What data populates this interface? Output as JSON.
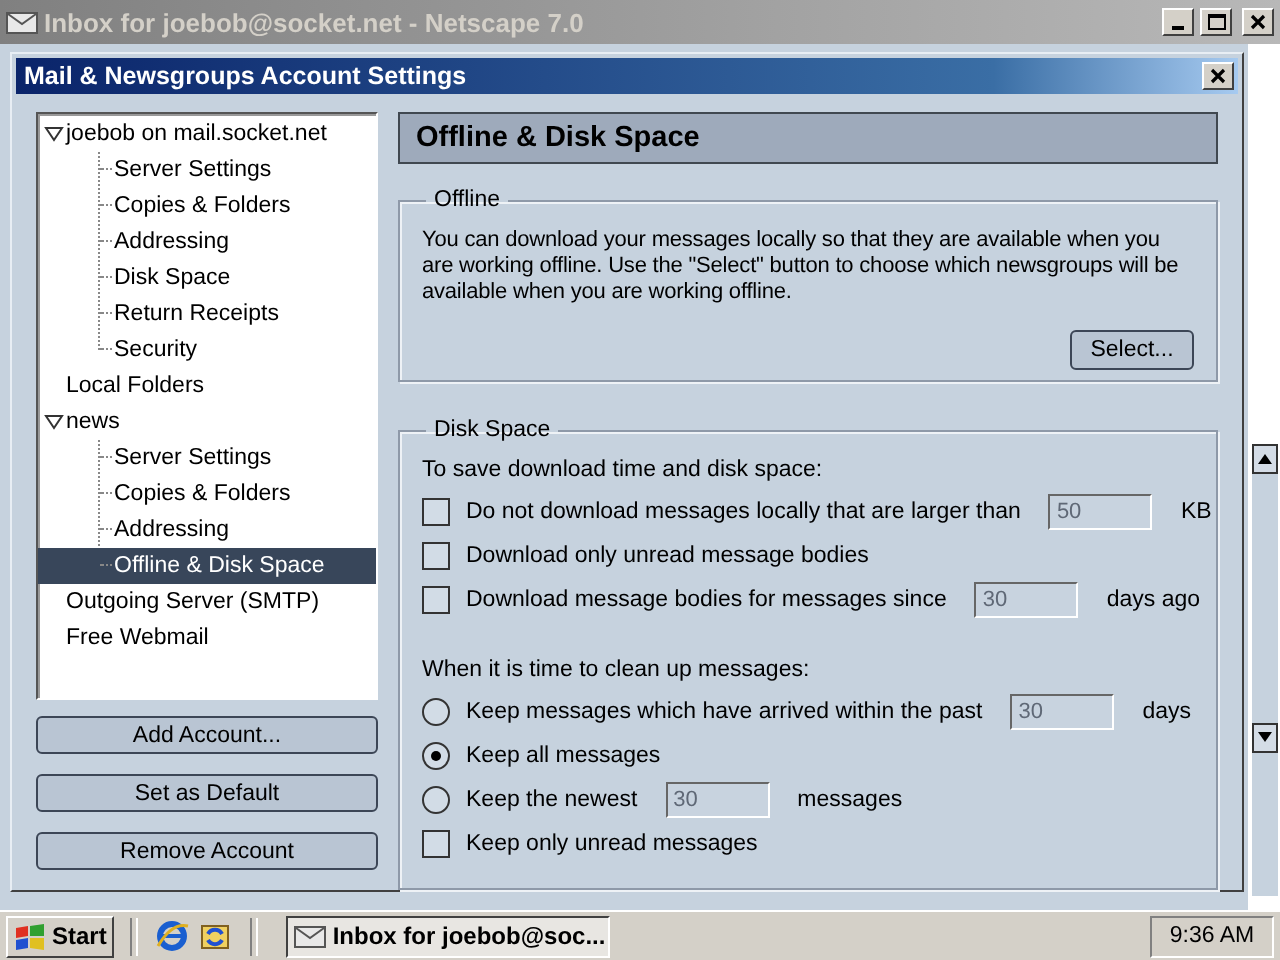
{
  "background_window": {
    "title": "Inbox for joebob@socket.net - Netscape 7.0"
  },
  "dialog": {
    "title": "Mail & Newsgroups Account Settings"
  },
  "tree": [
    {
      "label": "joebob on mail.socket.net",
      "expanded": true,
      "selected": false,
      "children": [
        {
          "label": "Server Settings",
          "selected": false
        },
        {
          "label": "Copies & Folders",
          "selected": false
        },
        {
          "label": "Addressing",
          "selected": false
        },
        {
          "label": "Disk Space",
          "selected": false
        },
        {
          "label": "Return Receipts",
          "selected": false
        },
        {
          "label": "Security",
          "selected": false
        }
      ]
    },
    {
      "label": "Local Folders",
      "selected": false
    },
    {
      "label": "news",
      "expanded": true,
      "selected": false,
      "children": [
        {
          "label": "Server Settings",
          "selected": false
        },
        {
          "label": "Copies & Folders",
          "selected": false
        },
        {
          "label": "Addressing",
          "selected": false
        },
        {
          "label": "Offline & Disk Space",
          "selected": true
        }
      ]
    },
    {
      "label": "Outgoing Server (SMTP)",
      "selected": false
    },
    {
      "label": "Free Webmail",
      "selected": false
    }
  ],
  "account_buttons": [
    "Add Account...",
    "Set as Default",
    "Remove Account"
  ],
  "panel": {
    "title": "Offline & Disk Space",
    "offline": {
      "legend": "Offline",
      "text": "You can download your messages locally so that they are available when you are working offline. Use the \"Select\" button to choose which newsgroups will be available when you are working offline.",
      "button": "Select..."
    },
    "disk_space": {
      "legend": "Disk Space",
      "intro": "To save download time and disk space:",
      "options": [
        {
          "kind": "checkbox",
          "label": "Do not download messages locally that are larger than",
          "checked": false,
          "field": {
            "value": "50",
            "disabled": true
          },
          "unit": "KB"
        },
        {
          "kind": "checkbox",
          "label": "Download only unread message bodies",
          "checked": false
        },
        {
          "kind": "checkbox",
          "label": "Download message bodies for messages since",
          "checked": false,
          "field": {
            "value": "30",
            "disabled": true
          },
          "unit": "days ago"
        }
      ],
      "cleanup_intro": "When it is time to clean up messages:",
      "cleanup": [
        {
          "kind": "radio",
          "label": "Keep messages which have arrived within the past",
          "selected": false,
          "field": {
            "value": "30",
            "disabled": true
          },
          "unit": "days"
        },
        {
          "kind": "radio",
          "label": "Keep all messages",
          "selected": true
        },
        {
          "kind": "radio",
          "label": "Keep the newest",
          "selected": false,
          "field": {
            "value": "30",
            "disabled": true
          },
          "unit": "messages"
        },
        {
          "kind": "checkbox",
          "label": "Keep only unread messages",
          "checked": false
        }
      ]
    }
  },
  "taskbar": {
    "start": "Start",
    "task": "Inbox for joebob@soc...",
    "clock": "9:36 AM"
  }
}
